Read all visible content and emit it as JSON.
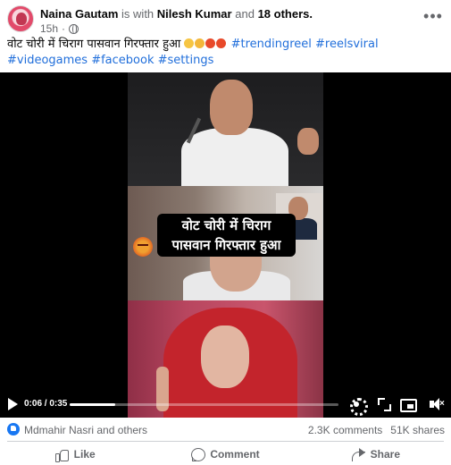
{
  "post": {
    "author": "Naina Gautam",
    "with_text": "is with",
    "tagged": "Nilesh Kumar",
    "and_text": "and",
    "others": "18 others.",
    "time": "15h",
    "audience_icon": "globe-icon",
    "caption_text": "वोट चोरी में चिराग पासवान गिरफ्तार हुआ",
    "caption_emojis": [
      "crying-face-emoji",
      "face-screaming-emoji",
      "angry-face-emoji",
      "angry-face-emoji"
    ],
    "hashtags": [
      "#trendingreel",
      "#reelsviral",
      "#videogames",
      "#facebook",
      "#settings"
    ]
  },
  "video": {
    "overlay_line1": "वोट चोरी में चिराग",
    "overlay_line2": "पासवान गिरफ्तार हुआ",
    "time_display": "0:06 / 0:35",
    "progress": 0.17,
    "controls": [
      "play-icon",
      "settings-icon",
      "fullscreen-icon",
      "picture-in-picture-icon",
      "mute-icon"
    ]
  },
  "stats": {
    "reactors": "Mdmahir Nasri and others",
    "comments": "2.3K comments",
    "shares": "51K shares"
  },
  "actions": {
    "like": "Like",
    "comment": "Comment",
    "share": "Share"
  },
  "colors": {
    "link": "#216fdb",
    "muted": "#65676b",
    "like_blue": "#1877f2"
  }
}
